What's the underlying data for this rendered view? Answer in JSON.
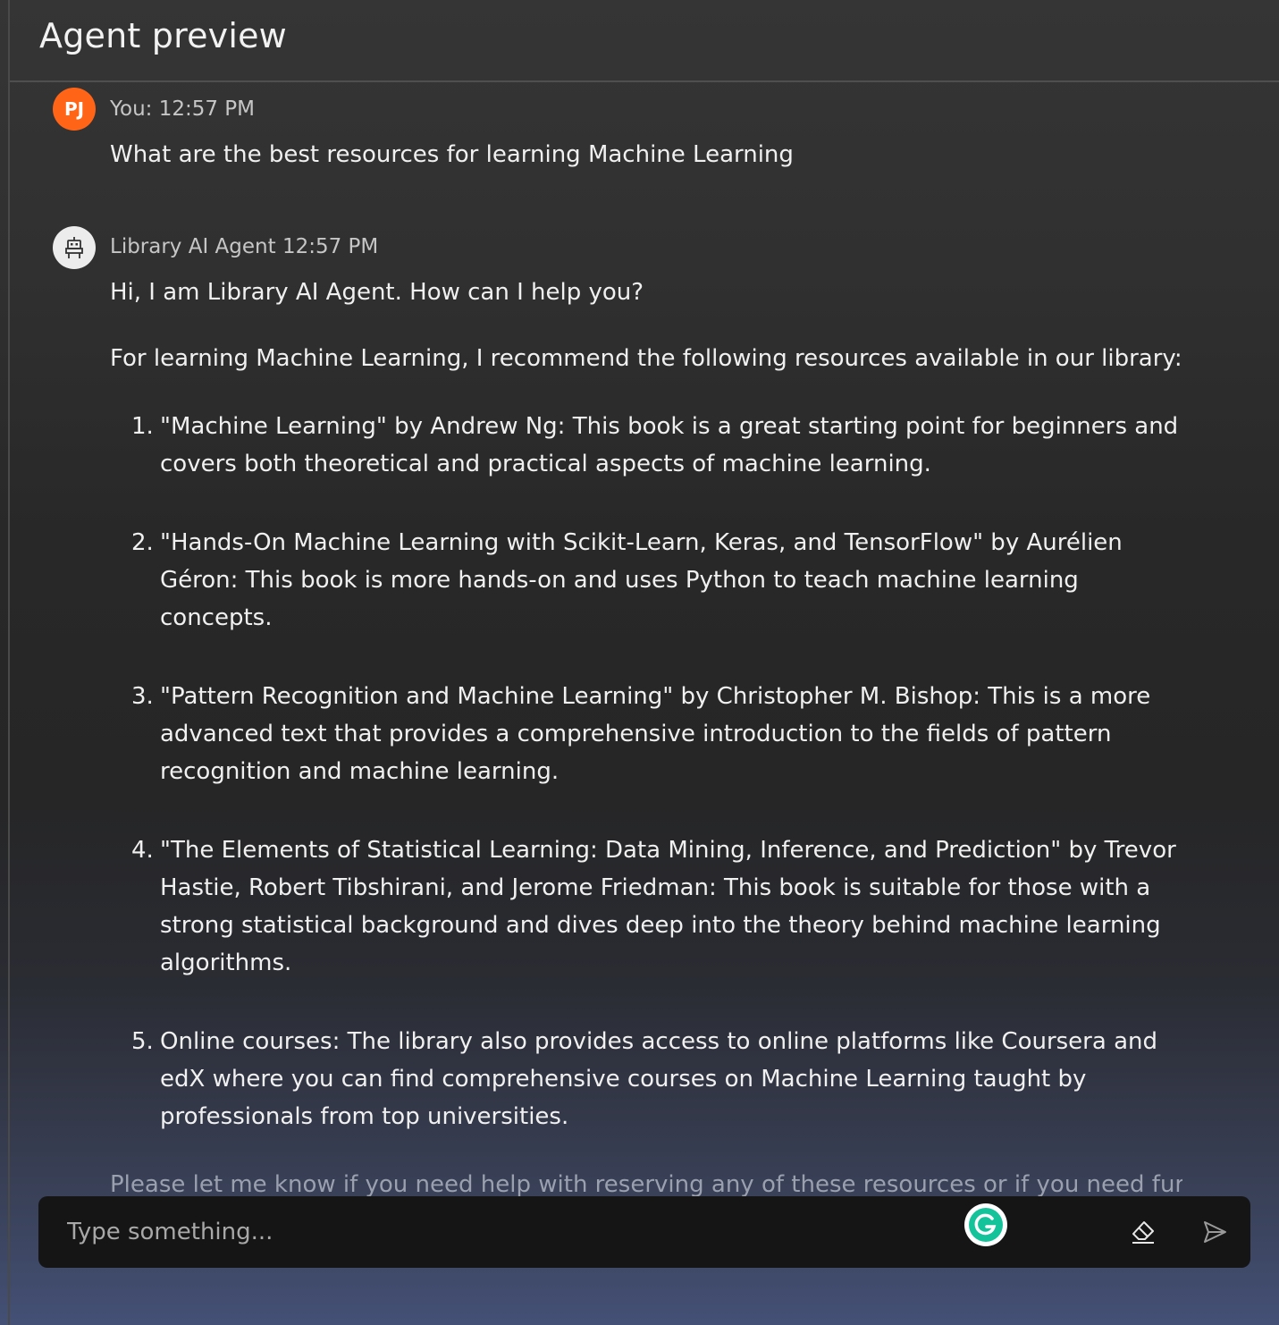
{
  "header": {
    "title": "Agent preview"
  },
  "user_message": {
    "avatar_initials": "PJ",
    "meta": "You: 12:57 PM",
    "text": "What are the best resources for learning Machine Learning"
  },
  "agent_message": {
    "meta": "Library AI Agent 12:57 PM",
    "greeting": "Hi, I am Library AI Agent. How can I help you?",
    "intro": "For learning Machine Learning, I recommend the following resources available in our library:",
    "items": [
      {
        "num": "1.",
        "text": "\"Machine Learning\" by Andrew Ng: This book is a great starting point for beginners and covers both theoretical and practical aspects of machine learning."
      },
      {
        "num": "2.",
        "text": "\"Hands-On Machine Learning with Scikit-Learn, Keras, and TensorFlow\" by Aurélien Géron: This book is more hands-on and uses Python to teach machine learning concepts."
      },
      {
        "num": "3.",
        "text": "\"Pattern Recognition and Machine Learning\" by Christopher M. Bishop: This is a more advanced text that provides a comprehensive introduction to the fields of pattern recognition and machine learning."
      },
      {
        "num": "4.",
        "text": "\"The Elements of Statistical Learning: Data Mining, Inference, and Prediction\" by Trevor Hastie, Robert Tibshirani, and Jerome Friedman: This book is suitable for those with a strong statistical background and dives deep into the theory behind machine learning algorithms."
      },
      {
        "num": "5.",
        "text": "Online courses: The library also provides access to online platforms like Coursera and edX where you can find comprehensive courses on Machine Learning taught by professionals from top universities."
      }
    ],
    "closing": "Please let me know if you need help with reserving any of these resources or if you need further"
  },
  "input": {
    "placeholder": "Type something..."
  },
  "icons": {
    "agent_avatar": "robot-icon",
    "grammarly": "grammarly-icon",
    "clear": "eraser-icon",
    "send": "send-icon"
  },
  "colors": {
    "user_avatar": "#ff6417",
    "input_bg": "#151515",
    "grammarly": "#15c39a"
  }
}
